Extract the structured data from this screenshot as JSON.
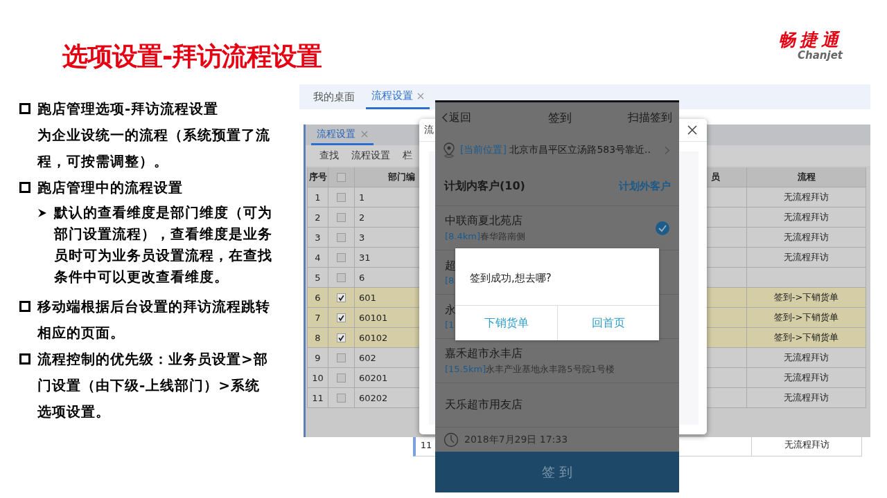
{
  "slide": {
    "title": "选项设置-拜访流程设置",
    "logo": {
      "name": "畅捷通",
      "latin": "Chanjet"
    }
  },
  "bullets": [
    {
      "text": "跑店管理选项-拜访流程设置",
      "note": "为企业设统一的流程（系统预置了流程，可按需调整）。"
    },
    {
      "text": "跑店管理中的流程设置",
      "children": [
        {
          "text": "默认的查看维度是部门维度（可为部门设置流程），查看维度是业务员时可为业务员设置流程，在查找条件中可以更改查看维度。"
        }
      ]
    },
    {
      "text": "移动端根据后台设置的拜访流程跳转相应的页面。"
    },
    {
      "text": "流程控制的优先级：业务员设置>部门设置（由下级-上线部门）>系统选项设置。"
    }
  ],
  "back_window": {
    "tabs": [
      {
        "label": "我的桌面",
        "selected": false,
        "closable": false
      },
      {
        "label": "流程设置",
        "selected": true,
        "closable": true
      }
    ],
    "visible_row": {
      "no": "11",
      "flow": "无流程拜访"
    }
  },
  "table_window": {
    "tab": {
      "label": "流程设置",
      "selected": true,
      "closable": true
    },
    "toolbar": [
      "查找",
      "流程设置",
      "栏"
    ],
    "columns": {
      "no": "序号",
      "code": "部门编",
      "salesman": "员",
      "flow": "流程"
    },
    "header_checked": false,
    "rows": [
      {
        "no": "1",
        "checked": false,
        "code": "1",
        "flow": "无流程拜访"
      },
      {
        "no": "2",
        "checked": false,
        "code": "2",
        "flow": "无流程拜访"
      },
      {
        "no": "3",
        "checked": false,
        "code": "3",
        "flow": "无流程拜访"
      },
      {
        "no": "4",
        "checked": false,
        "code": "31",
        "flow": "无流程拜访"
      },
      {
        "no": "5",
        "checked": false,
        "code": "6"
      },
      {
        "no": "6",
        "checked": true,
        "code": "601",
        "flow": "签到->下销货单"
      },
      {
        "no": "7",
        "checked": true,
        "code": "60101",
        "flow": "签到->下销货单"
      },
      {
        "no": "8",
        "checked": true,
        "code": "60102",
        "flow": "签到->下销货单"
      },
      {
        "no": "9",
        "checked": false,
        "code": "602",
        "flow": "无流程拜访"
      },
      {
        "no": "10",
        "checked": false,
        "code": "60201",
        "flow": "无流程拜访"
      },
      {
        "no": "11",
        "checked": false,
        "code": "60202",
        "flow": "无流程拜访"
      }
    ]
  },
  "dialog": {
    "title": "流"
  },
  "phone": {
    "back": "返回",
    "title": "签到",
    "action": "扫描签到",
    "location_tag": "[当前位置]",
    "location": "北京市昌平区立汤路583号靠近..",
    "planned": "计划内客户(10)",
    "unplanned": "计划外客户",
    "customers": [
      {
        "name": "中联商夏北苑店",
        "distance": "[8.4km]",
        "address": "春华路南侧",
        "checked": true
      },
      {
        "name": "超",
        "distance": "[8.",
        "checked": false
      },
      {
        "name": "永",
        "distance": "[1",
        "checked": false
      },
      {
        "name": "嘉禾超市永丰店",
        "distance": "[15.5km]",
        "address": "永丰产业基地永丰路5号院1号楼",
        "checked": false
      },
      {
        "name": "天乐超市用友店",
        "checked": false
      }
    ],
    "time": "2018年7月29日 17:33",
    "submit": "签 到",
    "modal": {
      "message": "签到成功,想去哪?",
      "buttons": [
        "下销货单",
        "回首页"
      ]
    }
  }
}
